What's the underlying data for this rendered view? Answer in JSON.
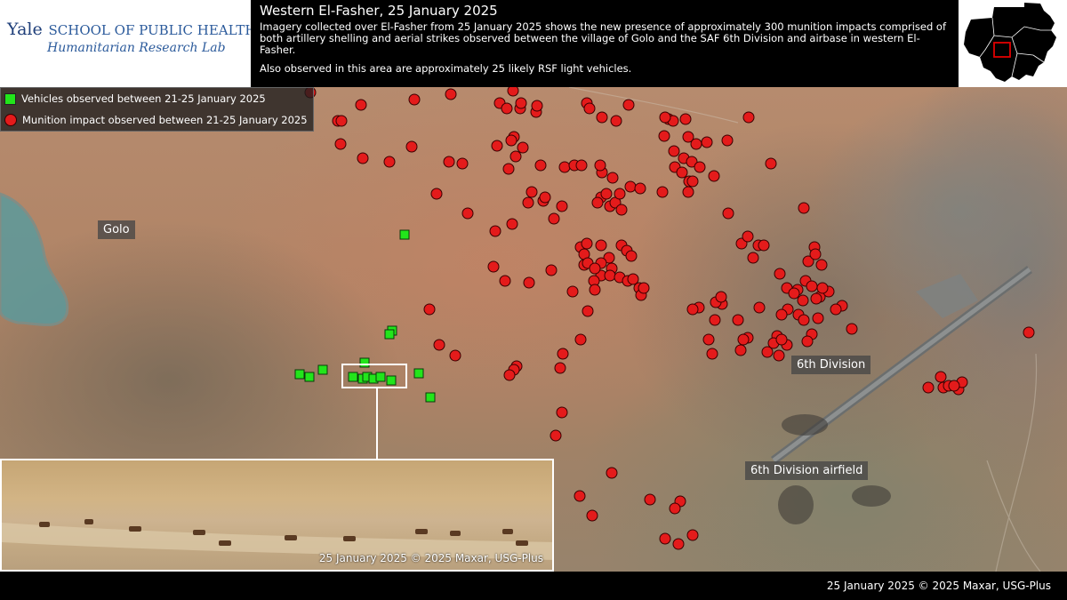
{
  "header": {
    "logo_school": "SCHOOL OF PUBLIC HEALTH",
    "logo_yale": "Yale",
    "logo_lab": "Humanitarian Research Lab",
    "title": "Western El-Fasher, 25 January 2025",
    "description": "Imagery collected over El-Fasher from 25 January 2025 shows the new presence of approximately 300 munition impacts comprised of both artillery shelling and aerial strikes observed between the village of Golo and the SAF 6th Division and airbase in western El-Fasher.",
    "note": "Also observed in this area are approximately 25 likely RSF light vehicles."
  },
  "legend": {
    "vehicles": "Vehicles observed between 21-25 January 2025",
    "impacts": "Munition impact observed between 21-25 January 2025"
  },
  "colors": {
    "impact": "#e41b1b",
    "vehicle": "#22e51b"
  },
  "labels": {
    "golo": "Golo",
    "division": "6th Division",
    "airfield": "6th Division airfield"
  },
  "inset": {
    "credit": "25 January 2025 © 2025 Maxar, USG-Plus"
  },
  "footer": {
    "credit": "25 January 2025 © 2025 Maxar, USG-Plus"
  }
}
